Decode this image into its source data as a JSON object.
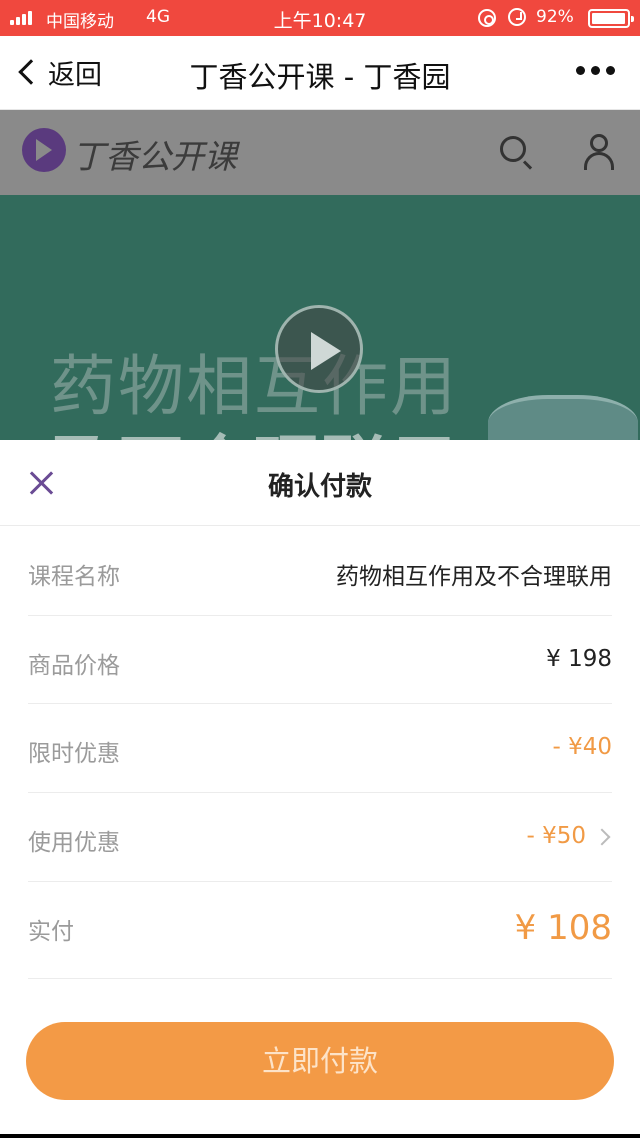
{
  "status_bar": {
    "carrier": "中国移动",
    "network": "4G",
    "time": "上午10:47",
    "battery": "92%"
  },
  "nav": {
    "back_label": "返回",
    "title": "丁香公开课 - 丁香园"
  },
  "site": {
    "name": "丁香公开课"
  },
  "video": {
    "title_line1": "药物相互作用",
    "title_line2": "及不合理联用"
  },
  "sheet": {
    "title": "确认付款",
    "rows": [
      {
        "label": "课程名称",
        "value": "药物相互作用及不合理联用"
      },
      {
        "label": "商品价格",
        "value": "¥ 198"
      },
      {
        "label": "限时优惠",
        "value": "- ¥40"
      },
      {
        "label": "使用优惠",
        "value": "- ¥50"
      },
      {
        "label": "实付",
        "value": "¥ 108"
      }
    ],
    "pay_label": "立即付款"
  },
  "colors": {
    "status_bar": "#f0483e",
    "accent_orange": "#f39a46",
    "close_purple": "#6a4b94",
    "video_bg": "#326b5c"
  }
}
